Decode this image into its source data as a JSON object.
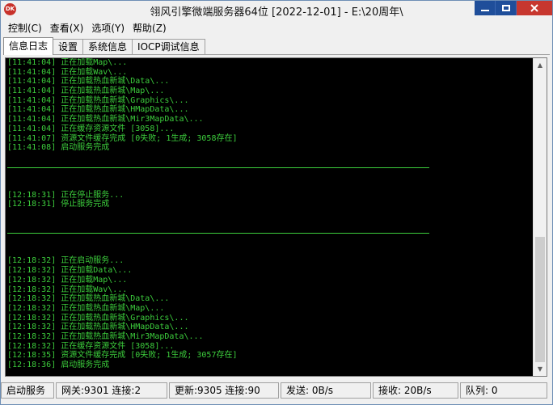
{
  "window": {
    "title": "翎风引擎微端服务器64位 [2022-12-01] - E:\\20周年\\",
    "icon_name": "app-logo-icon",
    "icon_text": "DK"
  },
  "menu": [
    {
      "label": "控制(C)"
    },
    {
      "label": "查看(X)"
    },
    {
      "label": "选项(Y)"
    },
    {
      "label": "帮助(Z)"
    }
  ],
  "tabs": [
    {
      "label": "信息日志",
      "active": true
    },
    {
      "label": "设置",
      "active": false
    },
    {
      "label": "系统信息",
      "active": false
    },
    {
      "label": "IOCP调试信息",
      "active": false
    }
  ],
  "log": {
    "color": "#3ccd3c",
    "lines": [
      {
        "type": "text",
        "text": "[11:41:04] 正在加载Map\\..."
      },
      {
        "type": "text",
        "text": "[11:41:04] 正在加载Wav\\..."
      },
      {
        "type": "text",
        "text": "[11:41:04] 正在加载热血新城\\Data\\..."
      },
      {
        "type": "text",
        "text": "[11:41:04] 正在加载热血新城\\Map\\..."
      },
      {
        "type": "text",
        "text": "[11:41:04] 正在加载热血新城\\Graphics\\..."
      },
      {
        "type": "text",
        "text": "[11:41:04] 正在加载热血新城\\HMapData\\..."
      },
      {
        "type": "text",
        "text": "[11:41:04] 正在加载热血新城\\Mir3MapData\\..."
      },
      {
        "type": "text",
        "text": "[11:41:04] 正在缓存资源文件 [3058]..."
      },
      {
        "type": "text",
        "text": "[11:41:07] 资源文件缓存完成 [0失败; 1生成; 3058存在]"
      },
      {
        "type": "text",
        "text": "[11:41:08] 启动服务完成"
      },
      {
        "type": "blank",
        "text": ""
      },
      {
        "type": "separator",
        "text": ""
      },
      {
        "type": "blank",
        "text": ""
      },
      {
        "type": "blank",
        "text": ""
      },
      {
        "type": "text",
        "text": "[12:18:31] 正在停止服务..."
      },
      {
        "type": "text",
        "text": "[12:18:31] 停止服务完成"
      },
      {
        "type": "blank",
        "text": ""
      },
      {
        "type": "blank",
        "text": ""
      },
      {
        "type": "separator",
        "text": ""
      },
      {
        "type": "blank",
        "text": ""
      },
      {
        "type": "blank",
        "text": ""
      },
      {
        "type": "text",
        "text": "[12:18:32] 正在启动服务..."
      },
      {
        "type": "text",
        "text": "[12:18:32] 正在加载Data\\..."
      },
      {
        "type": "text",
        "text": "[12:18:32] 正在加载Map\\..."
      },
      {
        "type": "text",
        "text": "[12:18:32] 正在加载Wav\\..."
      },
      {
        "type": "text",
        "text": "[12:18:32] 正在加载热血新城\\Data\\..."
      },
      {
        "type": "text",
        "text": "[12:18:32] 正在加载热血新城\\Map\\..."
      },
      {
        "type": "text",
        "text": "[12:18:32] 正在加载热血新城\\Graphics\\..."
      },
      {
        "type": "text",
        "text": "[12:18:32] 正在加载热血新城\\HMapData\\..."
      },
      {
        "type": "text",
        "text": "[12:18:32] 正在加载热血新城\\Mir3MapData\\..."
      },
      {
        "type": "text",
        "text": "[12:18:32] 正在缓存资源文件 [3058]..."
      },
      {
        "type": "text",
        "text": "[12:18:35] 资源文件缓存完成 [0失败; 1生成; 3057存在]"
      },
      {
        "type": "text",
        "text": "[12:18:36] 启动服务完成"
      }
    ]
  },
  "status": [
    {
      "label": "启动服务"
    },
    {
      "label": "网关:9301  连接:2"
    },
    {
      "label": "更新:9305  连接:90"
    },
    {
      "label": "发送: 0B/s"
    },
    {
      "label": "接收: 20B/s"
    },
    {
      "label": "队列: 0"
    }
  ]
}
